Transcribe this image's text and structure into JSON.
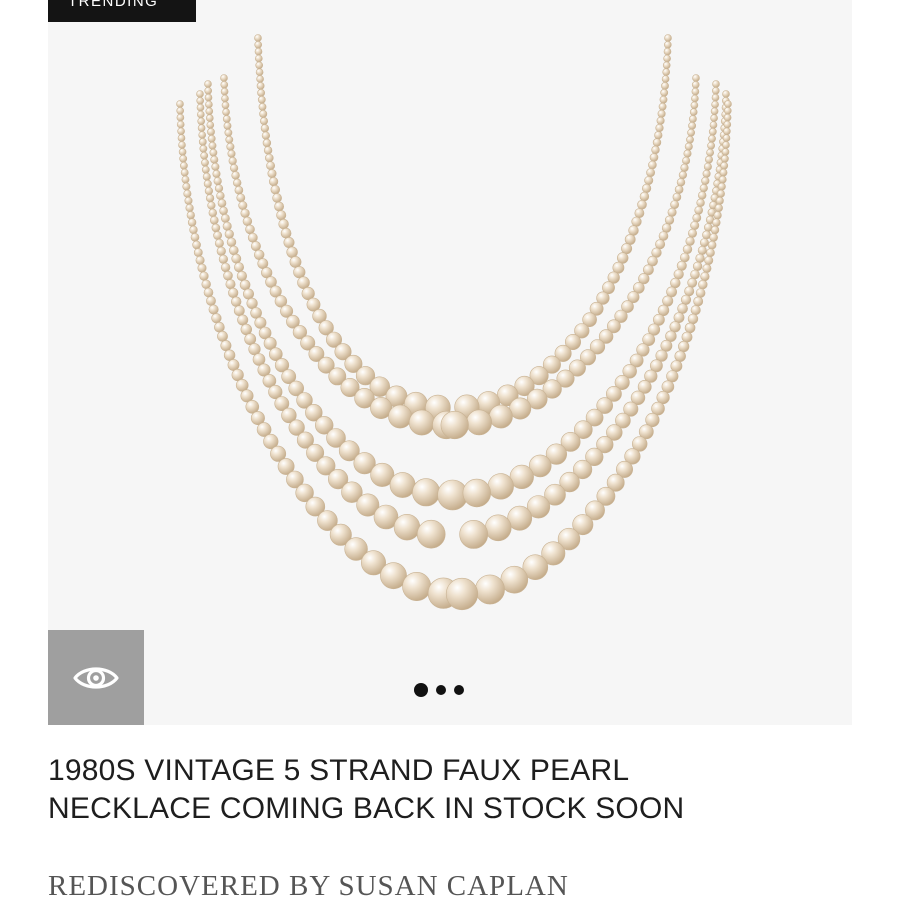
{
  "badge": {
    "label": "TRENDING"
  },
  "product": {
    "title_line1": "1980S VINTAGE 5 STRAND FAUX PEARL",
    "title_line2": "NECKLACE COMING BACK IN STOCK SOON",
    "brand": "REDISCOVERED BY SUSAN CAPLAN"
  },
  "gallery": {
    "image_count": 3,
    "active_index": 0,
    "image_subject": "pearl-necklace",
    "strand_count": 5
  },
  "quick_view": {
    "icon": "eye-icon"
  },
  "colors": {
    "pearl": "#efe2cf",
    "pearl_shade": "#c9b394",
    "background": "#f6f6f6",
    "quick_view_bg": "#9f9f9f",
    "badge_bg": "#141414",
    "title_text": "#1e1e1e",
    "brand_text": "#555555"
  }
}
